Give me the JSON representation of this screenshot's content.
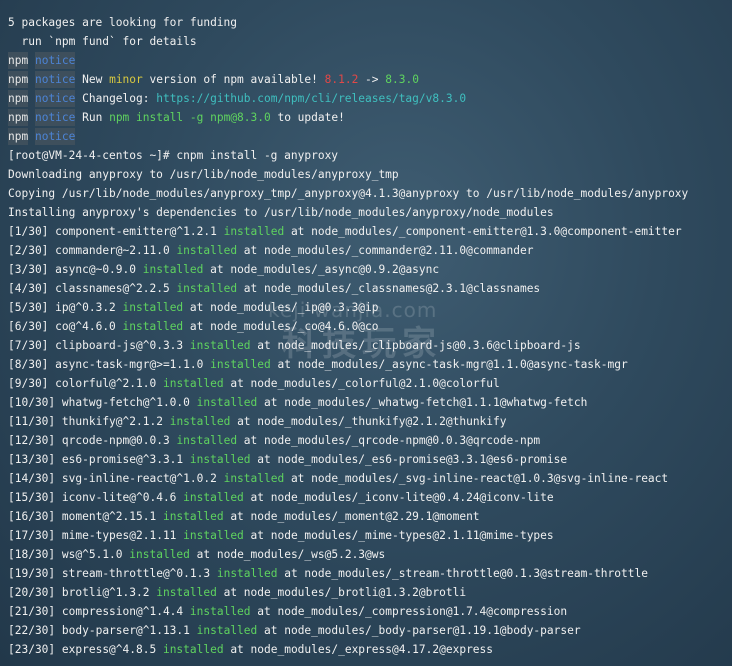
{
  "header_lines": [
    "5 packages are looking for funding",
    "  run `npm fund` for details"
  ],
  "npm_notices": [
    {
      "npm": "npm",
      "notice": "notice",
      "parts": []
    },
    {
      "npm": "npm",
      "notice": "notice",
      "parts": [
        {
          "t": " New ",
          "c": "w"
        },
        {
          "t": "minor",
          "c": "y"
        },
        {
          "t": " version of npm available! ",
          "c": "w"
        },
        {
          "t": "8.1.2",
          "c": "r"
        },
        {
          "t": " -> ",
          "c": "w"
        },
        {
          "t": "8.3.0",
          "c": "g"
        }
      ]
    },
    {
      "npm": "npm",
      "notice": "notice",
      "parts": [
        {
          "t": " Changelog: ",
          "c": "w"
        },
        {
          "t": "https://github.com/npm/cli/releases/tag/v8.3.0",
          "c": "c"
        }
      ]
    },
    {
      "npm": "npm",
      "notice": "notice",
      "parts": [
        {
          "t": " Run ",
          "c": "w"
        },
        {
          "t": "npm install -g npm@8.3.0",
          "c": "g"
        },
        {
          "t": " to update!",
          "c": "w"
        }
      ]
    },
    {
      "npm": "npm",
      "notice": "notice",
      "parts": []
    }
  ],
  "prompt_line": "[root@VM-24-4-centos ~]# cnpm install -g anyproxy",
  "info_lines": [
    "Downloading anyproxy to /usr/lib/node_modules/anyproxy_tmp",
    "Copying /usr/lib/node_modules/anyproxy_tmp/_anyproxy@4.1.3@anyproxy to /usr/lib/node_modules/anyproxy",
    "Installing anyproxy's dependencies to /usr/lib/node_modules/anyproxy/node_modules"
  ],
  "installs": [
    {
      "idx": "[1/30]",
      "pkg": "component-emitter@^1.2.1",
      "status": "installed",
      "path": "node_modules/_component-emitter@1.3.0@component-emitter"
    },
    {
      "idx": "[2/30]",
      "pkg": "commander@~2.11.0",
      "status": "installed",
      "path": "node_modules/_commander@2.11.0@commander"
    },
    {
      "idx": "[3/30]",
      "pkg": "async@~0.9.0",
      "status": "installed",
      "path": "node_modules/_async@0.9.2@async"
    },
    {
      "idx": "[4/30]",
      "pkg": "classnames@^2.2.5",
      "status": "installed",
      "path": "node_modules/_classnames@2.3.1@classnames"
    },
    {
      "idx": "[5/30]",
      "pkg": "ip@^0.3.2",
      "status": "installed",
      "path": "node_modules/_ip@0.3.3@ip"
    },
    {
      "idx": "[6/30]",
      "pkg": "co@^4.6.0",
      "status": "installed",
      "path": "node_modules/_co@4.6.0@co"
    },
    {
      "idx": "[7/30]",
      "pkg": "clipboard-js@^0.3.3",
      "status": "installed",
      "path": "node_modules/_clipboard-js@0.3.6@clipboard-js"
    },
    {
      "idx": "[8/30]",
      "pkg": "async-task-mgr@>=1.1.0",
      "status": "installed",
      "path": "node_modules/_async-task-mgr@1.1.0@async-task-mgr"
    },
    {
      "idx": "[9/30]",
      "pkg": "colorful@^2.1.0",
      "status": "installed",
      "path": "node_modules/_colorful@2.1.0@colorful"
    },
    {
      "idx": "[10/30]",
      "pkg": "whatwg-fetch@^1.0.0",
      "status": "installed",
      "path": "node_modules/_whatwg-fetch@1.1.1@whatwg-fetch"
    },
    {
      "idx": "[11/30]",
      "pkg": "thunkify@^2.1.2",
      "status": "installed",
      "path": "node_modules/_thunkify@2.1.2@thunkify"
    },
    {
      "idx": "[12/30]",
      "pkg": "qrcode-npm@0.0.3",
      "status": "installed",
      "path": "node_modules/_qrcode-npm@0.0.3@qrcode-npm"
    },
    {
      "idx": "[13/30]",
      "pkg": "es6-promise@^3.3.1",
      "status": "installed",
      "path": "node_modules/_es6-promise@3.3.1@es6-promise"
    },
    {
      "idx": "[14/30]",
      "pkg": "svg-inline-react@^1.0.2",
      "status": "installed",
      "path": "node_modules/_svg-inline-react@1.0.3@svg-inline-react"
    },
    {
      "idx": "[15/30]",
      "pkg": "iconv-lite@^0.4.6",
      "status": "installed",
      "path": "node_modules/_iconv-lite@0.4.24@iconv-lite"
    },
    {
      "idx": "[16/30]",
      "pkg": "moment@^2.15.1",
      "status": "installed",
      "path": "node_modules/_moment@2.29.1@moment"
    },
    {
      "idx": "[17/30]",
      "pkg": "mime-types@2.1.11",
      "status": "installed",
      "path": "node_modules/_mime-types@2.1.11@mime-types"
    },
    {
      "idx": "[18/30]",
      "pkg": "ws@^5.1.0",
      "status": "installed",
      "path": "node_modules/_ws@5.2.3@ws"
    },
    {
      "idx": "[19/30]",
      "pkg": "stream-throttle@^0.1.3",
      "status": "installed",
      "path": "node_modules/_stream-throttle@0.1.3@stream-throttle"
    },
    {
      "idx": "[20/30]",
      "pkg": "brotli@^1.3.2",
      "status": "installed",
      "path": "node_modules/_brotli@1.3.2@brotli"
    },
    {
      "idx": "[21/30]",
      "pkg": "compression@^1.4.4",
      "status": "installed",
      "path": "node_modules/_compression@1.7.4@compression"
    },
    {
      "idx": "[22/30]",
      "pkg": "body-parser@^1.13.1",
      "status": "installed",
      "path": "node_modules/_body-parser@1.19.1@body-parser"
    },
    {
      "idx": "[23/30]",
      "pkg": "express@^4.8.5",
      "status": "installed",
      "path": "node_modules/_express@4.17.2@express"
    }
  ],
  "watermark": {
    "line1": "keji wanjia.com",
    "line2": "科技玩家"
  },
  "colors": {
    "installed": "#5fd35f",
    "minor": "#d7c840",
    "old_version": "#e04848",
    "link": "#3fbfbf",
    "notice": "#4c84d6"
  }
}
